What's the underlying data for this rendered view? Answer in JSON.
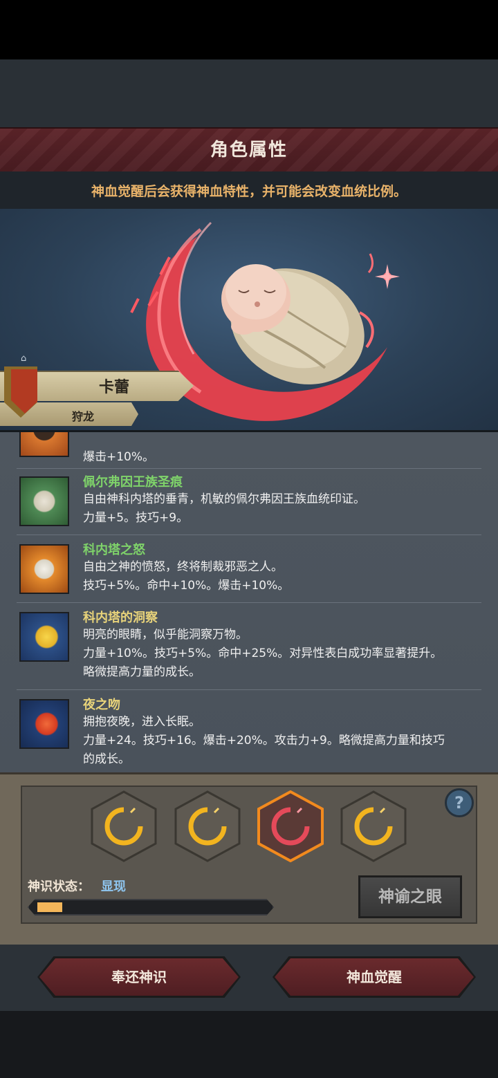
{
  "header": {
    "title": "角色属性",
    "subtitle": "神血觉醒后会获得神血特性，并可能会改变血统比例。"
  },
  "character": {
    "name": "卡蕾",
    "class": "狩龙"
  },
  "traits": [
    {
      "name": "",
      "desc": "爆击+10%。",
      "icon": "orange-eye-icon"
    },
    {
      "name": "佩尔弗因王族圣痕",
      "desc": "自由神科内塔的垂青，机敏的佩尔弗因王族血统印证。",
      "effect": "力量+5。技巧+9。",
      "color": "#7fd36a",
      "icon": "white-crescent-icon"
    },
    {
      "name": "科内塔之怒",
      "desc": "自由之神的愤怒，终将制裁邪恶之人。",
      "effect": "技巧+5%。命中+10%。爆击+10%。",
      "color": "#7fd36a",
      "icon": "smiling-sun-icon"
    },
    {
      "name": "科内塔的洞察",
      "desc": "明亮的眼睛，似乎能洞察万物。",
      "effect": "力量+10%。技巧+5%。命中+25%。对异性表白成功率显著提升。",
      "effect2": "略微提高力量的成长。",
      "color": "#e8d37a",
      "icon": "golden-moon-icon"
    },
    {
      "name": "夜之吻",
      "desc": "拥抱夜晚，进入长眠。",
      "effect": "力量+24。技巧+16。爆击+20%。攻击力+9。略微提高力量和技巧",
      "effect2": "的成长。",
      "color": "#e8d37a",
      "icon": "red-moon-icon"
    }
  ],
  "divine": {
    "status_label": "神识状态：",
    "status_value": "显现",
    "progress": 0.11,
    "oracle_button": "神谕之眼",
    "help": "?"
  },
  "buttons": {
    "return": "奉还神识",
    "awaken": "神血觉醒"
  },
  "colors": {
    "accent_gold": "#e9b36a",
    "accent_blue": "#8fc6f0",
    "header_red": "#5d2429"
  }
}
